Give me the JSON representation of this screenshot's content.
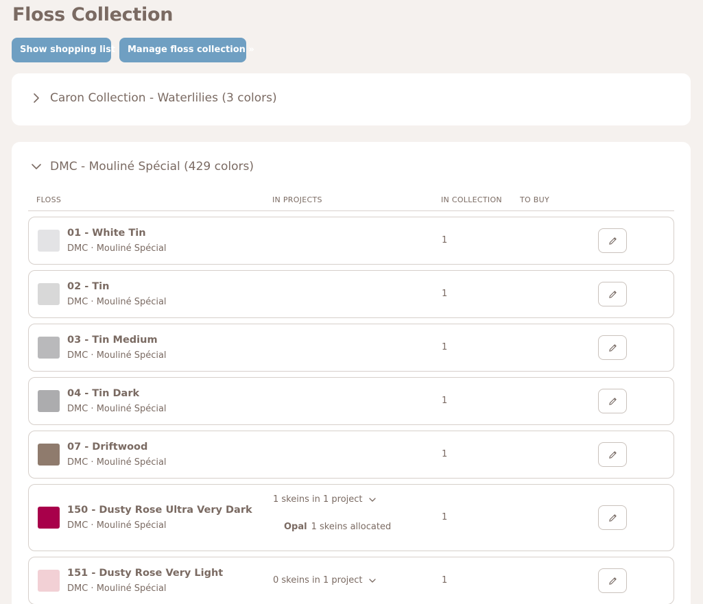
{
  "page": {
    "title": "Floss Collection"
  },
  "toolbar": {
    "shopping_label": "Show shopping list",
    "manage_label": "Manage floss collection »"
  },
  "collections": [
    {
      "title": "Caron Collection - Waterlilies (3 colors)",
      "expanded": false
    },
    {
      "title": "DMC - Mouliné Spécial (429 colors)",
      "expanded": true,
      "columns": {
        "floss": "FLOSS",
        "projects": "IN PROJECTS",
        "collection": "IN COLLECTION",
        "to_buy": "TO BUY"
      },
      "rows": [
        {
          "name": "01 - White Tin",
          "brand": "DMC · Mouliné Spécial",
          "count": "1",
          "swatch": "#e3e3e5"
        },
        {
          "name": "02 - Tin",
          "brand": "DMC · Mouliné Spécial",
          "count": "1",
          "swatch": "#d8d8d8"
        },
        {
          "name": "03 - Tin Medium",
          "brand": "DMC · Mouliné Spécial",
          "count": "1",
          "swatch": "#b9b9bb"
        },
        {
          "name": "04 - Tin Dark",
          "brand": "DMC · Mouliné Spécial",
          "count": "1",
          "swatch": "#acacae"
        },
        {
          "name": "07 - Driftwood",
          "brand": "DMC · Mouliné Spécial",
          "count": "1",
          "swatch": "#8f7b6d"
        },
        {
          "name": "150 - Dusty Rose Ultra Very Dark",
          "brand": "DMC · Mouliné Spécial",
          "count": "1",
          "swatch": "#a8004a",
          "projects_summary": "1 skeins in 1 project",
          "allocation": {
            "project": "Opal",
            "text": "1 skeins allocated"
          }
        },
        {
          "name": "151 - Dusty Rose Very Light",
          "brand": "DMC · Mouliné Spécial",
          "count": "1",
          "swatch": "#f2d0d5",
          "projects_summary": "0 skeins in 1 project"
        }
      ]
    }
  ],
  "icons": {
    "expand": "chevron-right-icon",
    "collapse": "chevron-down-icon",
    "edit": "pencil-icon",
    "toggle": "chevron-down-icon"
  },
  "colors": {
    "accent": "#6f9fc2",
    "background": "#f5f1ee",
    "text": "#7a6a62"
  }
}
